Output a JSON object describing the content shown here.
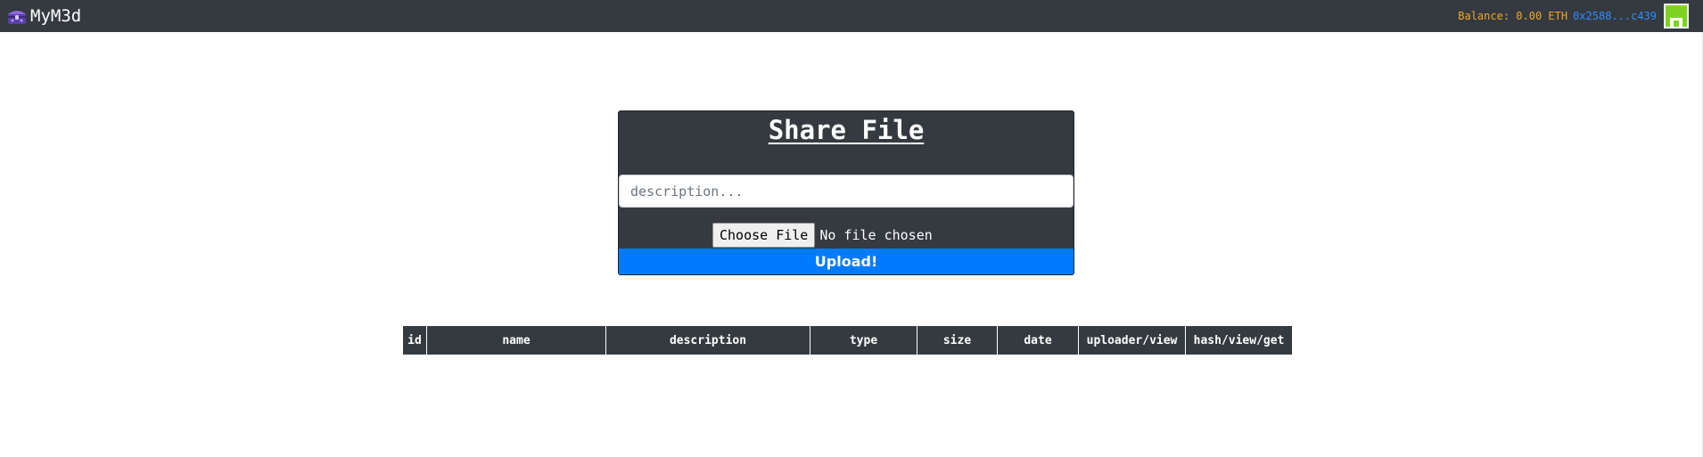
{
  "navbar": {
    "brand": "MyM3d",
    "brand_icon": "treasure-chest-icon",
    "balance": "Balance: 0.00 ETH",
    "account": "0x2588...c439",
    "avatar": "identicon-avatar",
    "colors": {
      "background": "#343a40",
      "balance": "#f5a623",
      "account": "#2f8cff",
      "avatar": "#7ed321"
    }
  },
  "share": {
    "title": "Share File",
    "description_placeholder": "description...",
    "description_value": "",
    "choose_file_label": "Choose File",
    "file_status": "No file chosen",
    "upload_label": "Upload!",
    "colors": {
      "card": "#343a40",
      "upload": "#007bff"
    }
  },
  "table": {
    "columns": [
      "id",
      "name",
      "description",
      "type",
      "size",
      "date",
      "uploader/view",
      "hash/view/get"
    ],
    "rows": []
  }
}
